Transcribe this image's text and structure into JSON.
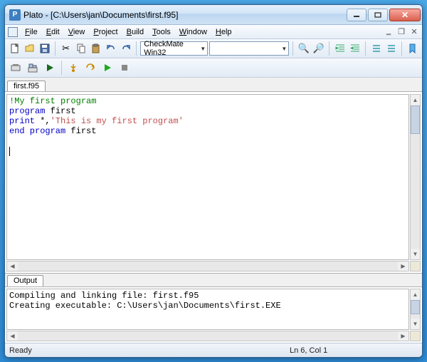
{
  "title": "Plato - [C:\\Users\\jan\\Documents\\first.f95]",
  "menu": {
    "file": "File",
    "edit": "Edit",
    "view": "View",
    "project": "Project",
    "build": "Build",
    "tools": "Tools",
    "window": "Window",
    "help": "Help"
  },
  "toolbar": {
    "config": "CheckMate Win32"
  },
  "tabs": {
    "file": "first.f95"
  },
  "code": {
    "l1_comment": "!My first program",
    "l2_kw": "program",
    "l2_id": " first",
    "l3_kw": "print",
    "l3_mid": " *,",
    "l3_str": "'This is my first program'",
    "l4_kw": "end program",
    "l4_id": " first"
  },
  "output": {
    "tab": "Output",
    "l1": "Compiling and linking file: first.f95",
    "l2": "Creating executable: C:\\Users\\jan\\Documents\\first.EXE"
  },
  "status": {
    "ready": "Ready",
    "pos": "Ln 6, Col 1"
  }
}
